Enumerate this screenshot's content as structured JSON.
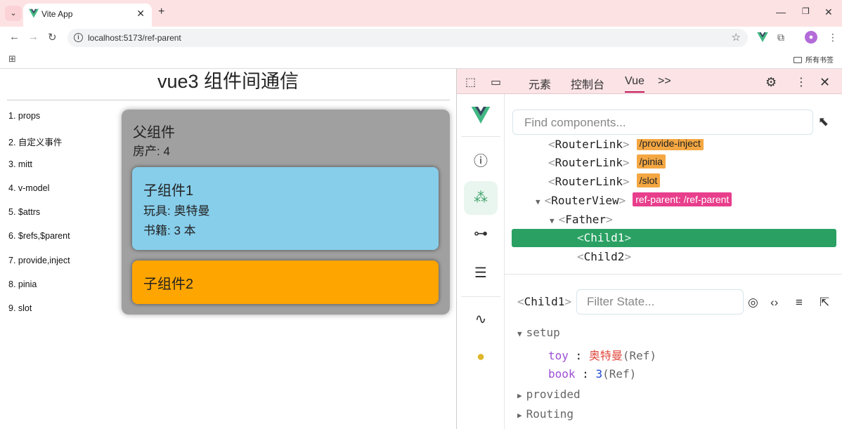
{
  "browser": {
    "tab_title": "Vite App",
    "url": "localhost:5173/ref-parent",
    "bookmarks_folder": "所有书签"
  },
  "page": {
    "title": "vue3 组件间通信",
    "nav": [
      "1. props",
      "2. 自定义事件",
      "3. mitt",
      "4. v-model",
      "5. $attrs",
      "6. $refs,$parent",
      "7. provide,inject",
      "8. pinia",
      "9. slot"
    ],
    "father": {
      "heading": "父组件",
      "line": "房产: 4"
    },
    "child1": {
      "heading": "子组件1",
      "toy_line": "玩具: 奥特曼",
      "book_line": "书籍: 3 本"
    },
    "child2": {
      "heading": "子组件2"
    }
  },
  "devtools": {
    "tabs": {
      "elements": "元素",
      "console": "控制台",
      "vue": "Vue",
      "more": ">>"
    },
    "find_placeholder": "Find components...",
    "tree": [
      {
        "name": "RouterLink",
        "tag": "/provide-inject"
      },
      {
        "name": "RouterLink",
        "tag": "/pinia"
      },
      {
        "name": "RouterLink",
        "tag": "/slot"
      },
      {
        "name": "RouterView",
        "tag": "ref-parent: /ref-parent"
      },
      {
        "name": "Father"
      },
      {
        "name": "Child1"
      },
      {
        "name": "Child2"
      }
    ],
    "state": {
      "component": "Child1",
      "filter_placeholder": "Filter State...",
      "sections": {
        "setup": "setup",
        "provided": "provided",
        "routing": "Routing"
      },
      "props": [
        {
          "key": "toy",
          "value": "奥特曼",
          "type": "(Ref)"
        },
        {
          "key": "book",
          "value": "3",
          "type": "(Ref)"
        }
      ]
    }
  },
  "colors": {
    "father_bg": "#a0a0a0",
    "child1_bg": "#87ceeb",
    "child2_bg": "#ffa500",
    "selected_row": "#2aa163",
    "vue_green": "#41b883"
  }
}
